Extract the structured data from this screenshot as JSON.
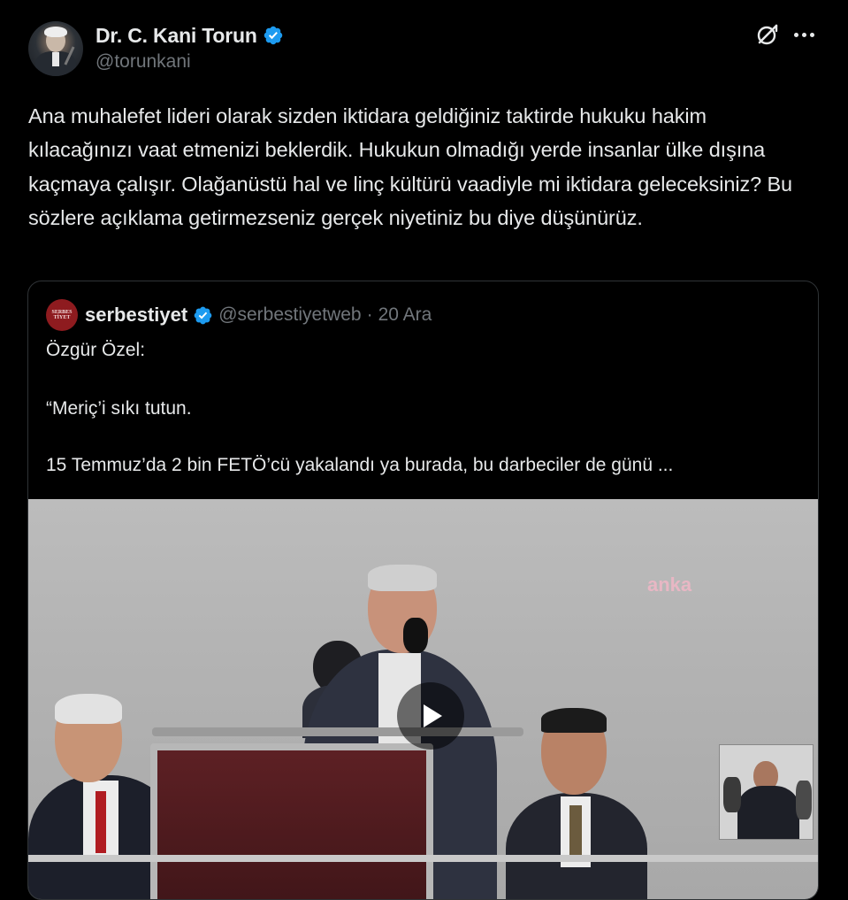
{
  "author": {
    "display_name": "Dr. C. Kani Torun",
    "handle": "@torunkani",
    "verified": true
  },
  "header_icons": [
    "grok-icon",
    "more-icon"
  ],
  "tweet_text": "Ana muhalefet lideri olarak sizden iktidara geldiğiniz taktirde hukuku hakim kılacağınızı vaat etmenizi beklerdik. Hukukun olmadığı yerde insanlar ülke dışına kaçmaya çalışır. Olağanüstü hal ve linç kültürü vaadiyle mi iktidara geleceksiniz? Bu sözlere açıklama getirmezseniz gerçek niyetiniz bu diye düşünürüz.",
  "quoted": {
    "display_name": "serbestiyet",
    "handle": "@serbestiyetweb",
    "separator": "·",
    "date": "20 Ara",
    "verified": true,
    "avatar_text": "SERBESTİYET",
    "lines": [
      "Özgür Özel:",
      "“Meriç’i sıkı tutun.",
      "15 Temmuz’da 2 bin FETÖ’cü yakalandı ya burada, bu darbeciler de günü ..."
    ],
    "video": {
      "watermark": "anka",
      "has_play_button": true,
      "has_sign_language_inset": true
    }
  },
  "colors": {
    "background": "#000000",
    "text": "#e7e9ea",
    "secondary": "#71767b",
    "verified_blue": "#1d9bf0",
    "border": "#2f3336"
  }
}
